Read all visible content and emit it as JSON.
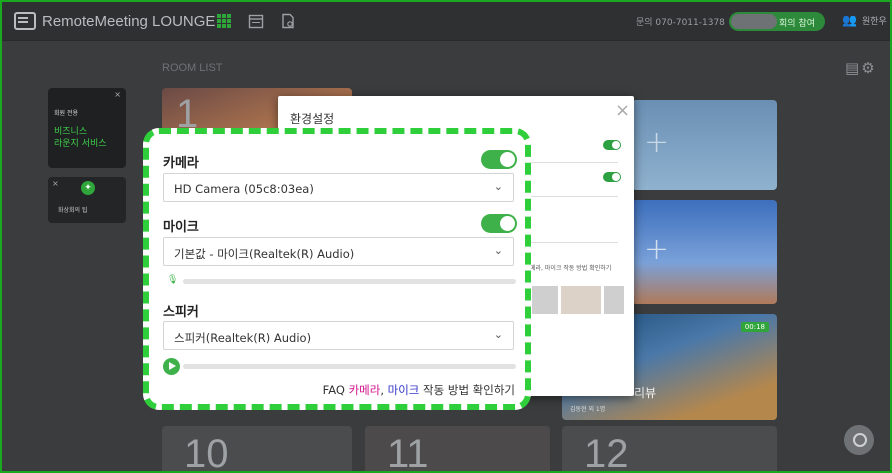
{
  "app": {
    "title": "RemoteMeeting LOUNGE"
  },
  "header": {
    "contact": "문의 070-7011-1378",
    "toggle_label": "회의 참여",
    "user_name": "원한우"
  },
  "main": {
    "room_list_label": "ROOM LIST",
    "side_card_1": {
      "line1": "회원 전용",
      "line2": "비즈니스",
      "line3": "라운지 서비스"
    },
    "side_card_2": {
      "label": "화상회의 팁"
    },
    "room_numbers": [
      "1",
      "10",
      "11",
      "12"
    ],
    "room_badge": "00:18",
    "room_owner": "김동현 외 1명",
    "room_title_fragment": "리뷰"
  },
  "settings_modal": {
    "title": "환경설정",
    "faq_fragment": "메라, 마이크 작동 방법 확인하기"
  },
  "zoom_panel": {
    "camera_label": "카메라",
    "camera_value": "HD Camera (05c8:03ea)",
    "mic_label": "마이크",
    "mic_value": "기본값 - 마이크(Realtek(R) Audio)",
    "speaker_label": "스피커",
    "speaker_value": "스피커(Realtek(R) Audio)",
    "faq_prefix": "FAQ ",
    "faq_camera": "카메라",
    "faq_comma": ", ",
    "faq_mic": "마이크",
    "faq_suffix": " 작동 방법 확인하기"
  },
  "colors": {
    "accent_green": "#3fb14b",
    "highlight_dash": "#2fcf3b",
    "frame_border": "#19a81f"
  }
}
